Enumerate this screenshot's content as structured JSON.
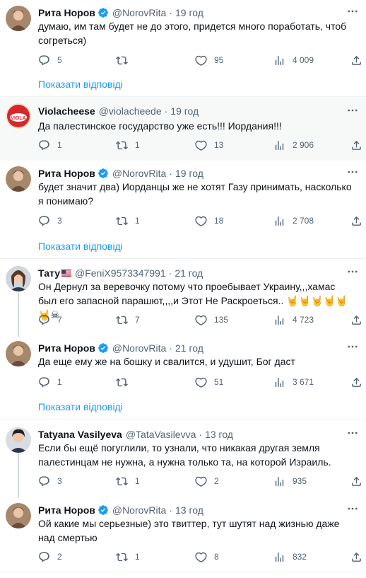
{
  "tweets": [
    {
      "name": "Рита Норов",
      "handle": "@NorovRita",
      "time": "19 год",
      "verified": true,
      "text": "думаю, им там будет не до этого, придется много поработать, чтоб согреться)",
      "replies": "5",
      "retweets": "",
      "likes": "95",
      "views": "4 009",
      "show_replies": "Показати відповіді"
    },
    {
      "name": "Violacheese",
      "handle": "@violacheede",
      "time": "19 год",
      "verified": false,
      "text": "Да палестинское государство уже есть!!! Иордания!!!",
      "replies": "1",
      "retweets": "1",
      "likes": "13",
      "views": "2 906"
    },
    {
      "name": "Рита Норов",
      "handle": "@NorovRita",
      "time": "19 год",
      "verified": true,
      "text": "будет значит два) Иорданцы же не хотят Газу принимать, насколько я понимаю?",
      "replies": "3",
      "retweets": "1",
      "likes": "18",
      "views": "2 708",
      "show_replies": "Показати відповіді"
    },
    {
      "name": "Тату",
      "handle": "@FeniX9573347991",
      "time": "21 год",
      "verified": false,
      "text": "Он Дернул за веревочку потому что проебывает Украину,,,хамас был его запасной парашют,,,,и Этот Не Раскроеться.. 🤘🤘🤘🤘🤘🤘☠",
      "replies": "7",
      "retweets": "7",
      "likes": "135",
      "views": "4 723"
    },
    {
      "name": "Рита Норов",
      "handle": "@NorovRita",
      "time": "21 год",
      "verified": true,
      "text": "Да еще ему же на бошку и свалится, и удушит, Бог даст",
      "replies": "1",
      "retweets": "",
      "likes": "51",
      "views": "3 671",
      "show_replies": "Показати відповіді"
    },
    {
      "name": "Tatyana Vasilyeva",
      "handle": "@TataVasilevva",
      "time": "13 год",
      "verified": false,
      "text": "Если бы ещё погуглили, то узнали, что никакая другая земля палестинцам не нужна, а нужна только та, на которой Израиль.",
      "replies": "3",
      "retweets": "1",
      "likes": "2",
      "views": "935"
    },
    {
      "name": "Рита Норов",
      "handle": "@NorovRita",
      "time": "13 год",
      "verified": true,
      "text": "Ой какие мы серьезные) это твиттер, тут шутят над жизнью даже над смертью",
      "replies": "2",
      "retweets": "1",
      "likes": "8",
      "views": "832"
    }
  ],
  "colors": {
    "link": "#1d9bf0",
    "muted": "#536471",
    "verified": "#1d9bf0",
    "divider": "#eff3f4"
  },
  "icons": [
    "reply-icon",
    "retweet-icon",
    "like-icon",
    "views-icon",
    "share-icon",
    "more-icon",
    "verified-badge-icon"
  ]
}
